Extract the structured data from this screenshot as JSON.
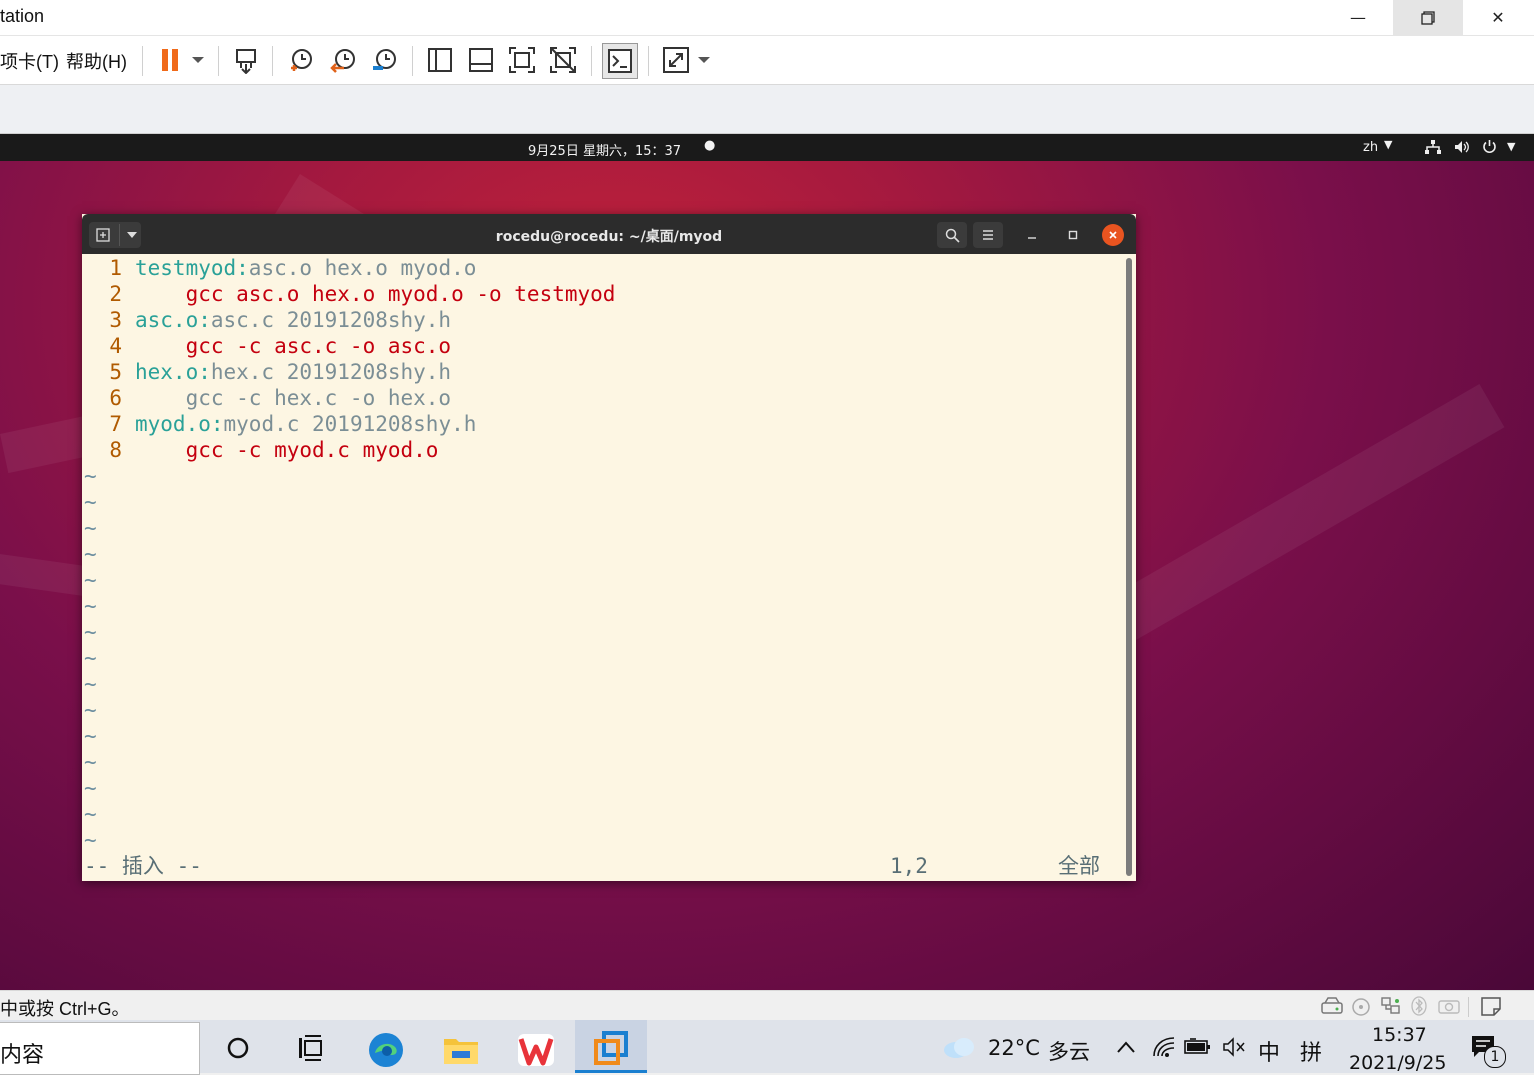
{
  "window": {
    "title": "tation"
  },
  "menu": [
    {
      "label": "项卡(T)"
    },
    {
      "label": "帮助(H)"
    }
  ],
  "toolbar_icons": [
    "pause-icon",
    "send-ctrl-alt-del-icon",
    "snapshot-icon",
    "revert-snapshot-icon",
    "snapshot-manager-icon",
    "show-library-icon",
    "show-thumbnail-icon",
    "fit-guest-icon",
    "unity-icon",
    "console-view-icon",
    "fullscreen-icon"
  ],
  "ubuntu": {
    "clock": "9月25日 星期六，15：37",
    "lang": "zh"
  },
  "terminal": {
    "title": "rocedu@rocedu: ~/桌面/myod",
    "lines": [
      {
        "num": "1",
        "segments": [
          {
            "text": "testmyod:",
            "color": "#2aa198"
          },
          {
            "text": "asc.o hex.o myod.o",
            "color": "#7b8e95"
          }
        ]
      },
      {
        "num": "2",
        "segments": [
          {
            "text": "    gcc asc.o hex.o myod.o -o testmyod",
            "color": "#c4000f"
          }
        ]
      },
      {
        "num": "3",
        "segments": [
          {
            "text": "asc.o:",
            "color": "#2aa198"
          },
          {
            "text": "asc.c 20191208shy.h",
            "color": "#7b8e95"
          }
        ]
      },
      {
        "num": "4",
        "segments": [
          {
            "text": "    gcc -c asc.c -o asc.o",
            "color": "#c4000f"
          }
        ]
      },
      {
        "num": "5",
        "segments": [
          {
            "text": "hex.o:",
            "color": "#2aa198"
          },
          {
            "text": "hex.c 20191208shy.h",
            "color": "#7b8e95"
          }
        ]
      },
      {
        "num": "6",
        "segments": [
          {
            "text": "    gcc -c hex.c -o hex.o",
            "color": "#7b8e95"
          }
        ]
      },
      {
        "num": "7",
        "segments": [
          {
            "text": "myod.o:",
            "color": "#2aa198"
          },
          {
            "text": "myod.c 20191208shy.h",
            "color": "#7b8e95"
          }
        ]
      },
      {
        "num": "8",
        "segments": [
          {
            "text": "    gcc -c myod.c myod.o",
            "color": "#c4000f"
          }
        ]
      }
    ],
    "tilde_count": 15,
    "tilde": "~",
    "mode": "-- 插入 --",
    "position": "1,2",
    "scroll": "全部"
  },
  "statusbar": {
    "hint": "中或按 Ctrl+G。"
  },
  "taskbar": {
    "search_text": "内容",
    "weather_temp": "22°C",
    "weather_desc": "多云",
    "ime_lang": "中",
    "ime_mode": "拼",
    "time": "15:37",
    "date": "2021/9/25",
    "notification_count": "1"
  }
}
